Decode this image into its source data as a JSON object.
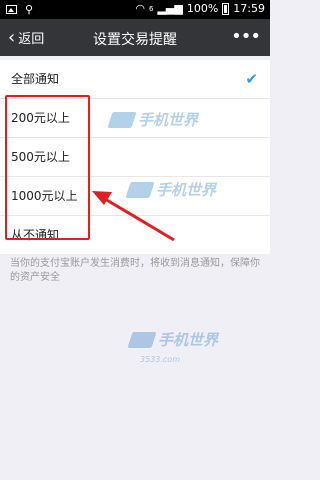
{
  "status_bar": {
    "battery": "100%",
    "time": "17:59",
    "network": "6"
  },
  "nav": {
    "back_label": "返回",
    "title": "设置交易提醒",
    "more_icon": "more-icon"
  },
  "options": [
    {
      "label": "全部通知",
      "selected": true
    },
    {
      "label": "200元以上",
      "selected": false
    },
    {
      "label": "500元以上",
      "selected": false
    },
    {
      "label": "1000元以上",
      "selected": false
    },
    {
      "label": "从不通知",
      "selected": false
    }
  ],
  "hint": "当你的支付宝账户发生消费时，将收到消息通知，保障你的资产安全",
  "watermark": {
    "text": "手机世界",
    "sub": "3533.com"
  },
  "colors": {
    "accent": "#2a9ed8",
    "annotation": "#e01f24",
    "nav_bg": "#333539"
  }
}
